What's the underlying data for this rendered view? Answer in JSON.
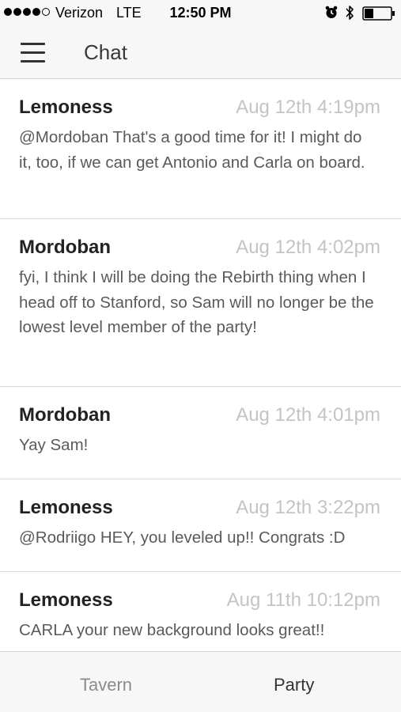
{
  "status_bar": {
    "carrier": "Verizon",
    "network": "LTE",
    "time": "12:50 PM",
    "signal_strength": 4,
    "signal_max": 5,
    "battery_level": 0.35,
    "icons": [
      "alarm-clock-icon",
      "bluetooth-icon",
      "battery-icon"
    ]
  },
  "nav": {
    "title": "Chat",
    "menu_icon": "hamburger-menu-icon"
  },
  "messages": [
    {
      "author": "Lemoness",
      "time": "Aug 12th 4:19pm",
      "text": "@Mordoban That's a good time for it! I might do it, too, if we can get Antonio and Carla on board."
    },
    {
      "author": "Mordoban",
      "time": "Aug 12th 4:02pm",
      "text": "fyi, I think I will be doing the Rebirth thing when I head off to Stanford, so Sam will no longer be the lowest level member of the party!"
    },
    {
      "author": "Mordoban",
      "time": "Aug 12th 4:01pm",
      "text": "Yay Sam!"
    },
    {
      "author": "Lemoness",
      "time": "Aug 12th 3:22pm",
      "text": "@Rodriigo HEY, you leveled up!! Congrats :D"
    },
    {
      "author": "Lemoness",
      "time": "Aug 11th 10:12pm",
      "text": "CARLA your new background looks great!!"
    }
  ],
  "tabs": [
    {
      "label": "Tavern",
      "active": false
    },
    {
      "label": "Party",
      "active": true
    }
  ],
  "colors": {
    "bar_background": "#f7f7f7",
    "author": "#222222",
    "timestamp": "#c4c4c4",
    "body_text": "#5a5a5a",
    "divider": "#d8d8d8",
    "tab_inactive": "#8b8b8b",
    "tab_active": "#333333"
  }
}
